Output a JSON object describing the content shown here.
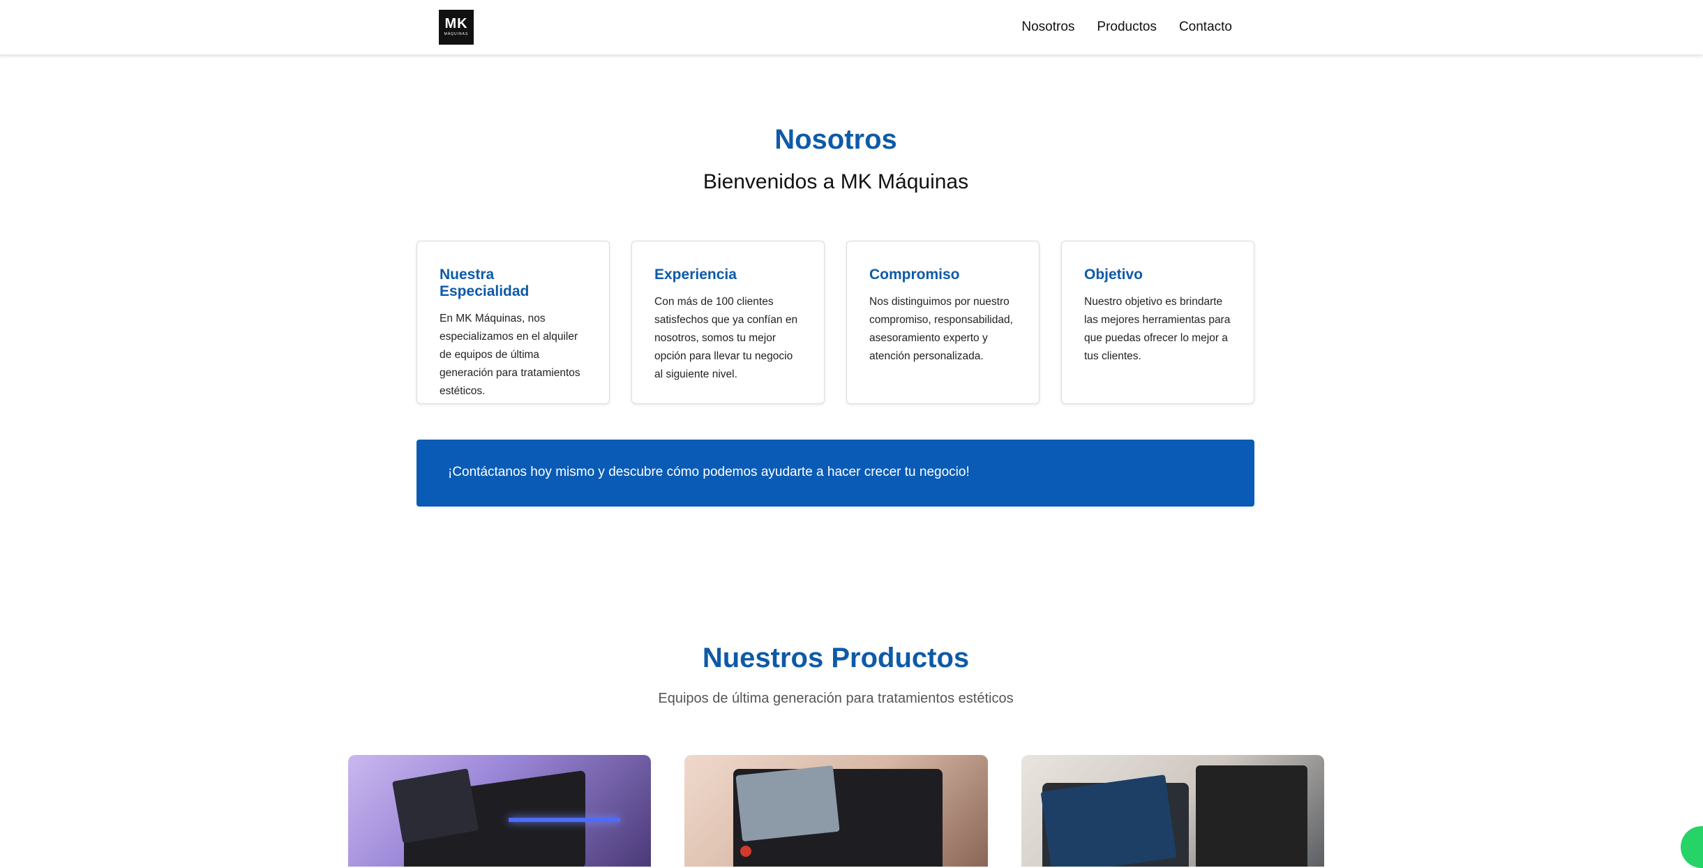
{
  "header": {
    "logo_main": "MK",
    "logo_sub": "MÁQUINAS",
    "nav": [
      "Nosotros",
      "Productos",
      "Contacto"
    ]
  },
  "about": {
    "title": "Nosotros",
    "subtitle": "Bienvenidos a MK Máquinas",
    "cards": [
      {
        "title": "Nuestra Especialidad",
        "text": "En MK Máquinas, nos especializamos en el alquiler de equipos de última generación para tratamientos estéticos."
      },
      {
        "title": "Experiencia",
        "text": "Con más de 100 clientes satisfechos que ya confían en nosotros, somos tu mejor opción para llevar tu negocio al siguiente nivel."
      },
      {
        "title": "Compromiso",
        "text": "Nos distinguimos por nuestro compromiso, responsabilidad, asesoramiento experto y atención personalizada."
      },
      {
        "title": "Objetivo",
        "text": "Nuestro objetivo es brindarte las mejores herramientas para que puedas ofrecer lo mejor a tus clientes."
      }
    ],
    "banner": "¡Contáctanos hoy mismo y descubre cómo podemos ayudarte a hacer crecer tu negocio!"
  },
  "products": {
    "title": "Nuestros Productos",
    "subtitle": "Equipos de última generación para tratamientos estéticos"
  },
  "colors": {
    "accent": "#0e5aa7",
    "banner": "#0a5bb5",
    "whatsapp": "#25d366"
  }
}
